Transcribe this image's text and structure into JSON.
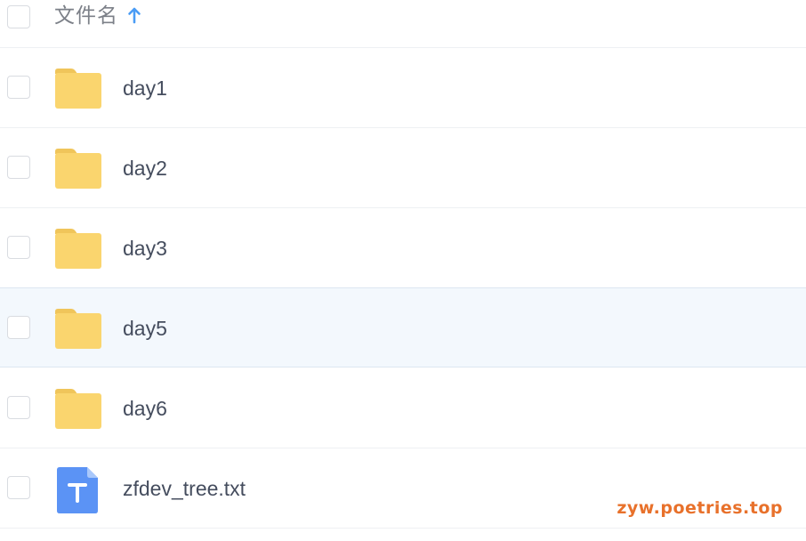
{
  "header": {
    "column_name_label": "文件名",
    "sort_icon": "arrow-up-icon",
    "sort_direction": "ascending"
  },
  "files": [
    {
      "name": "day1",
      "type": "folder",
      "icon": "folder-icon"
    },
    {
      "name": "day2",
      "type": "folder",
      "icon": "folder-icon"
    },
    {
      "name": "day3",
      "type": "folder",
      "icon": "folder-icon"
    },
    {
      "name": "day5",
      "type": "folder",
      "icon": "folder-icon",
      "highlighted": true
    },
    {
      "name": "day6",
      "type": "folder",
      "icon": "folder-icon"
    },
    {
      "name": "zfdev_tree.txt",
      "type": "text-file",
      "icon": "text-file-icon"
    }
  ],
  "watermark": "zyw.poetries.top",
  "colors": {
    "folder": "#fad56e",
    "folder_tab": "#f0c55a",
    "text_file": "#5b93f5",
    "sort_arrow": "#4a9cf5",
    "row_highlight": "#f3f8fd",
    "watermark": "#e8712b",
    "file_name_text": "#454d5e"
  }
}
